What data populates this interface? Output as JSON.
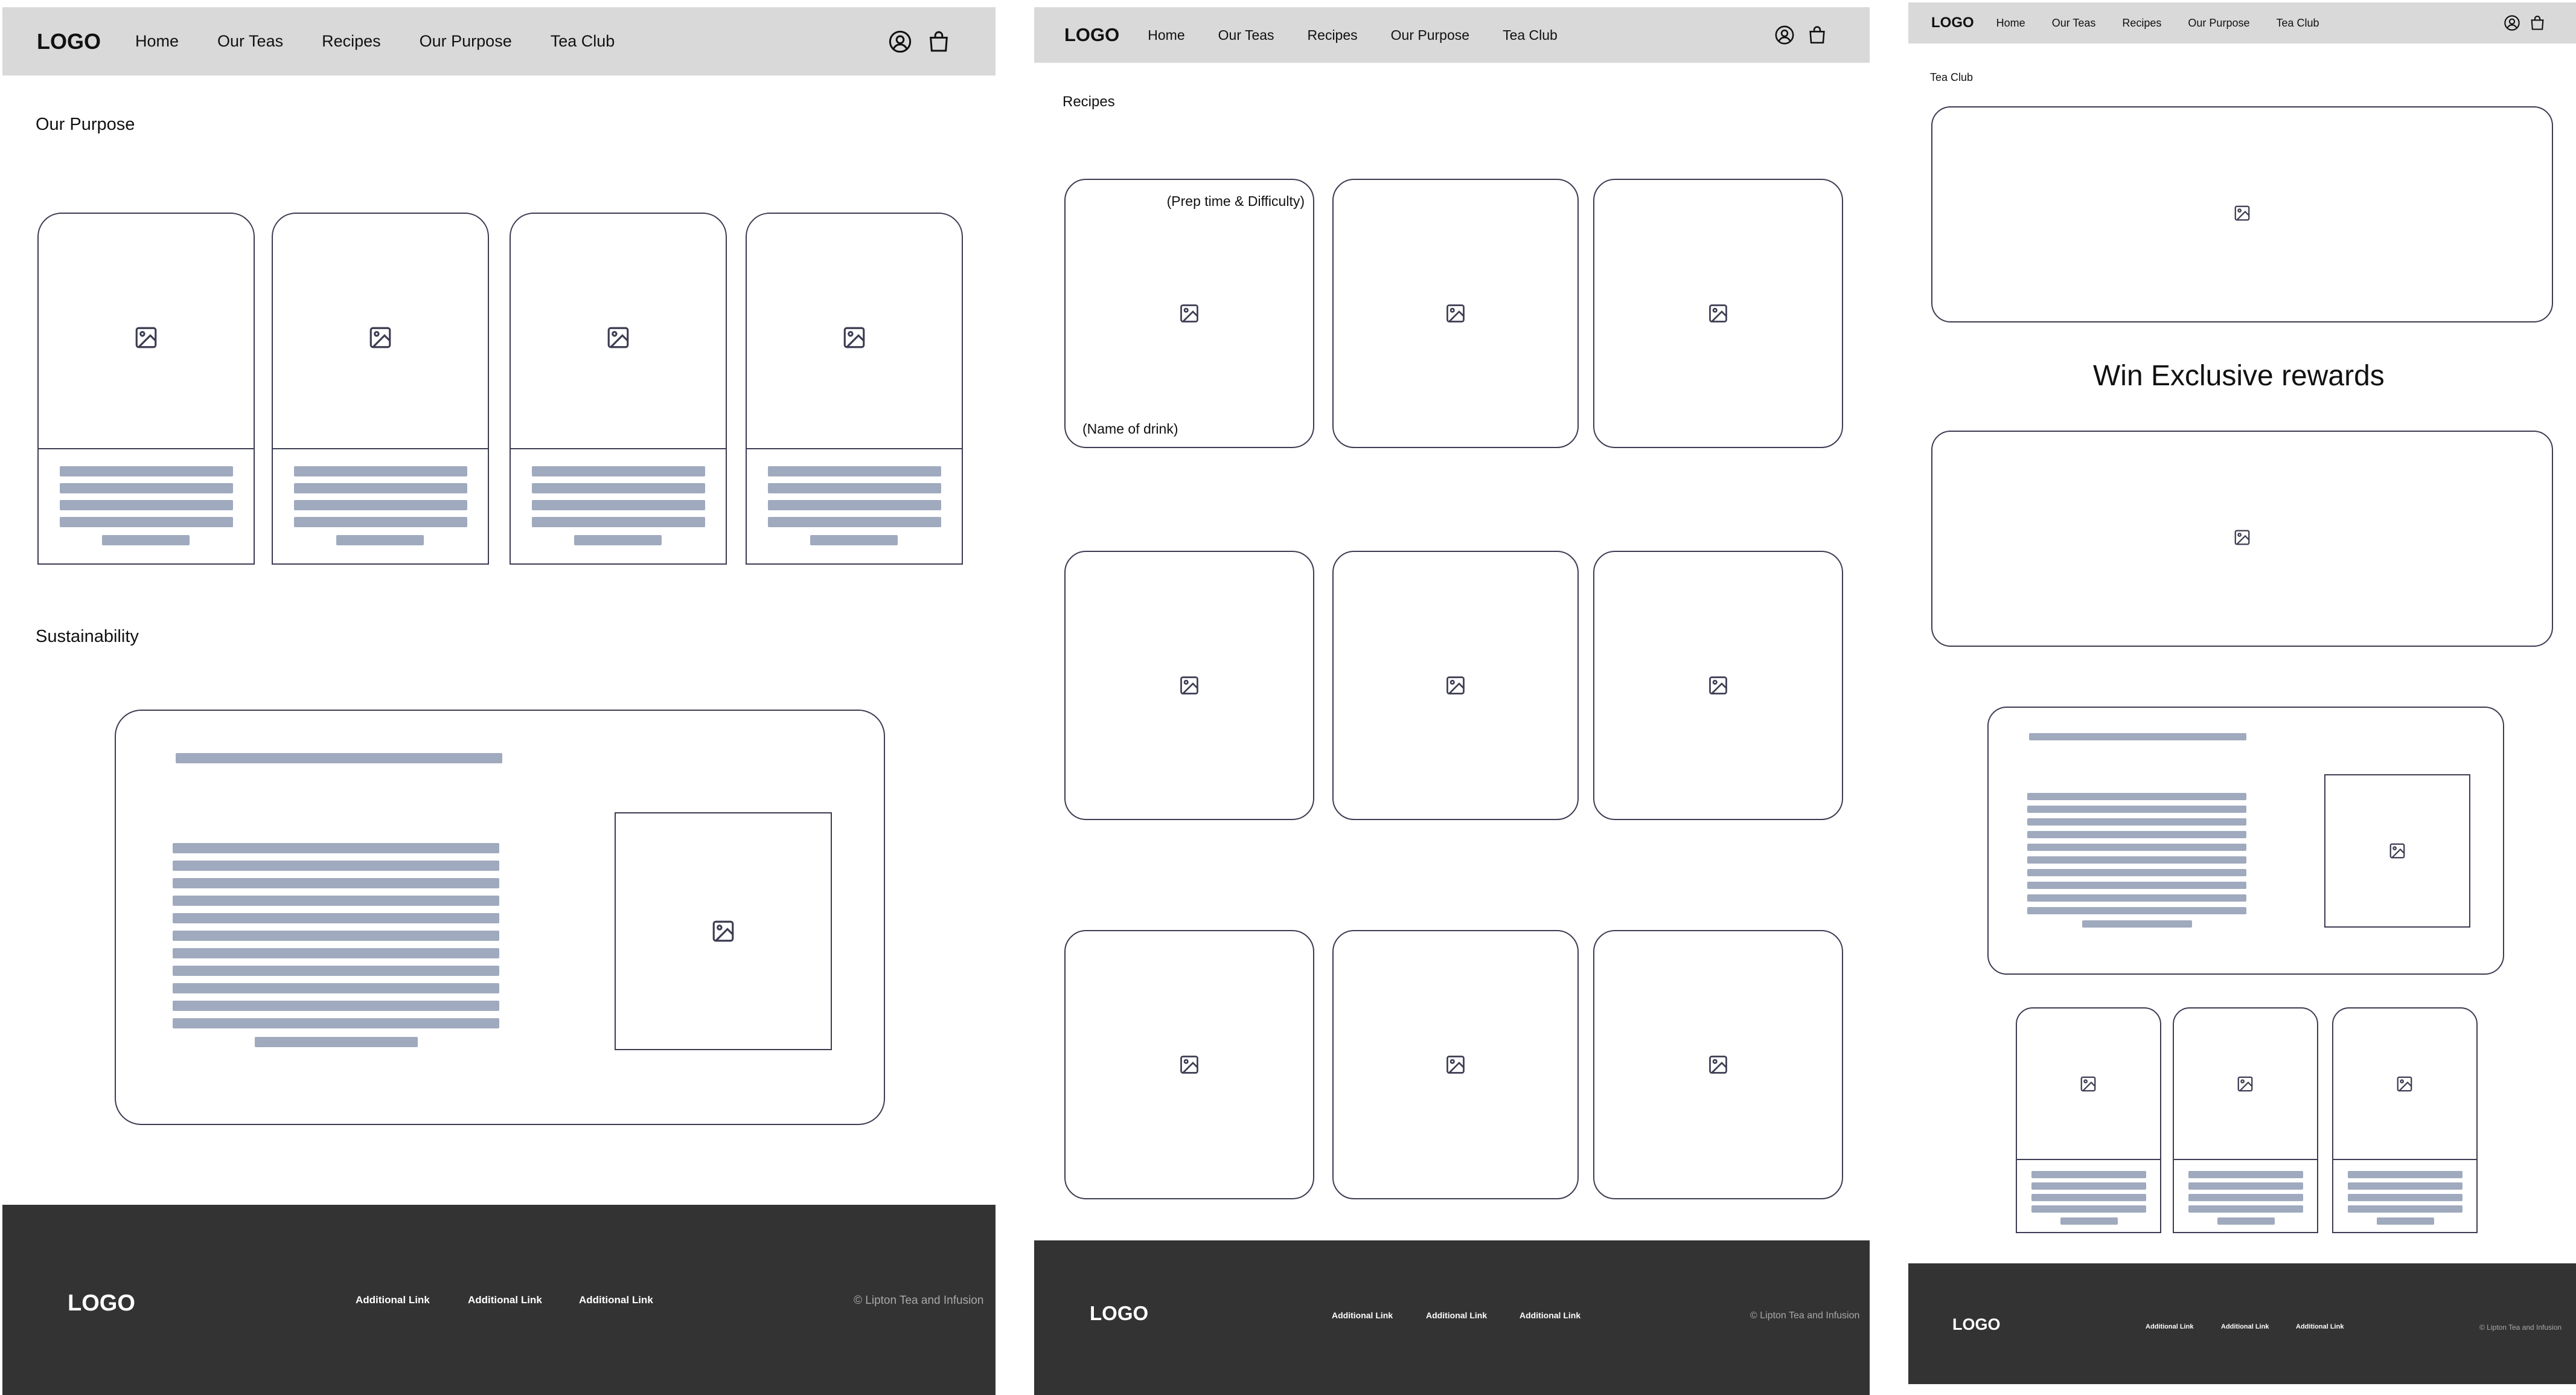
{
  "colors": {
    "nav_bg": "#d9d9d9",
    "footer_bg": "#333333",
    "card_border": "#3c3c52",
    "placeholder_bar": "#a0aabe"
  },
  "nav": {
    "logo": "LOGO",
    "items": [
      "Home",
      "Our Teas",
      "Recipes",
      "Our Purpose",
      "Tea Club"
    ],
    "icons": [
      "account-icon",
      "shopping-bag-icon"
    ]
  },
  "footer": {
    "logo": "LOGO",
    "links": [
      "Additional Link",
      "Additional Link",
      "Additional Link"
    ],
    "copyright": "© Lipton Tea and Infusion"
  },
  "purpose_page": {
    "title": "Our Purpose",
    "sustainability_title": "Sustainability"
  },
  "recipes_page": {
    "title": "Recipes",
    "card_top_label": "(Prep time & Difficulty)",
    "card_bottom_label": "(Name of drink)"
  },
  "teaclub_page": {
    "title": "Tea Club",
    "headline": "Win Exclusive rewards"
  }
}
